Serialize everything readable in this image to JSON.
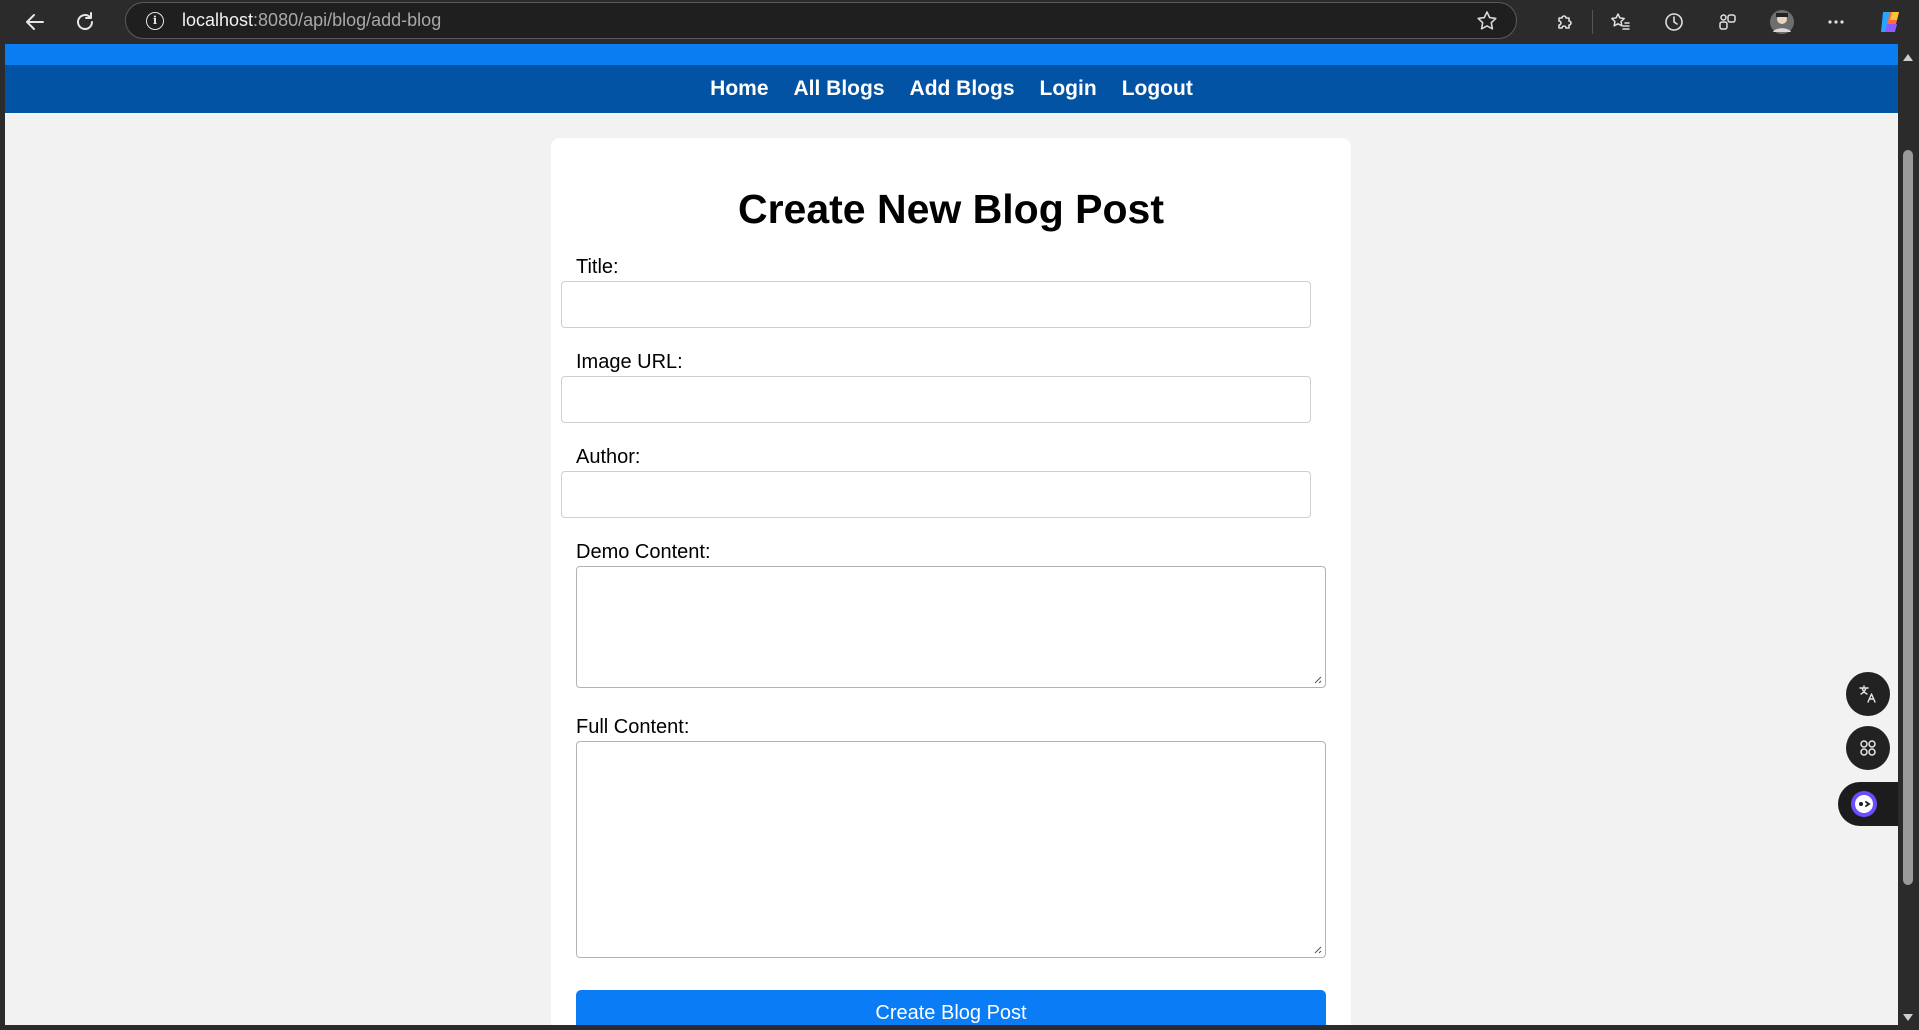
{
  "browser": {
    "url_host": "localhost",
    "url_path": ":8080/api/blog/add-blog"
  },
  "nav": {
    "items": [
      "Home",
      "All Blogs",
      "Add Blogs",
      "Login",
      "Logout"
    ]
  },
  "form": {
    "heading": "Create New Blog Post",
    "title_label": "Title:",
    "image_label": "Image URL:",
    "author_label": "Author:",
    "demo_label": "Demo Content:",
    "full_label": "Full Content:",
    "submit_label": "Create Blog Post"
  },
  "icons": {
    "back": "arrow-left-icon",
    "reload": "reload-icon",
    "info": "info-icon",
    "favorite": "star-icon",
    "extensions": "puzzle-icon",
    "favorites": "favorites-list-icon",
    "history": "history-icon",
    "workspaces": "workspaces-icon",
    "profile": "avatar",
    "more": "ellipsis-icon",
    "copilot": "copilot-icon",
    "translate": "translate-icon",
    "apps": "grid-icon",
    "assistant": "assistant-icon"
  },
  "colors": {
    "nav_bg": "#0353a4",
    "accent": "#0a7cf5",
    "page_bg": "#f2f2f2"
  }
}
